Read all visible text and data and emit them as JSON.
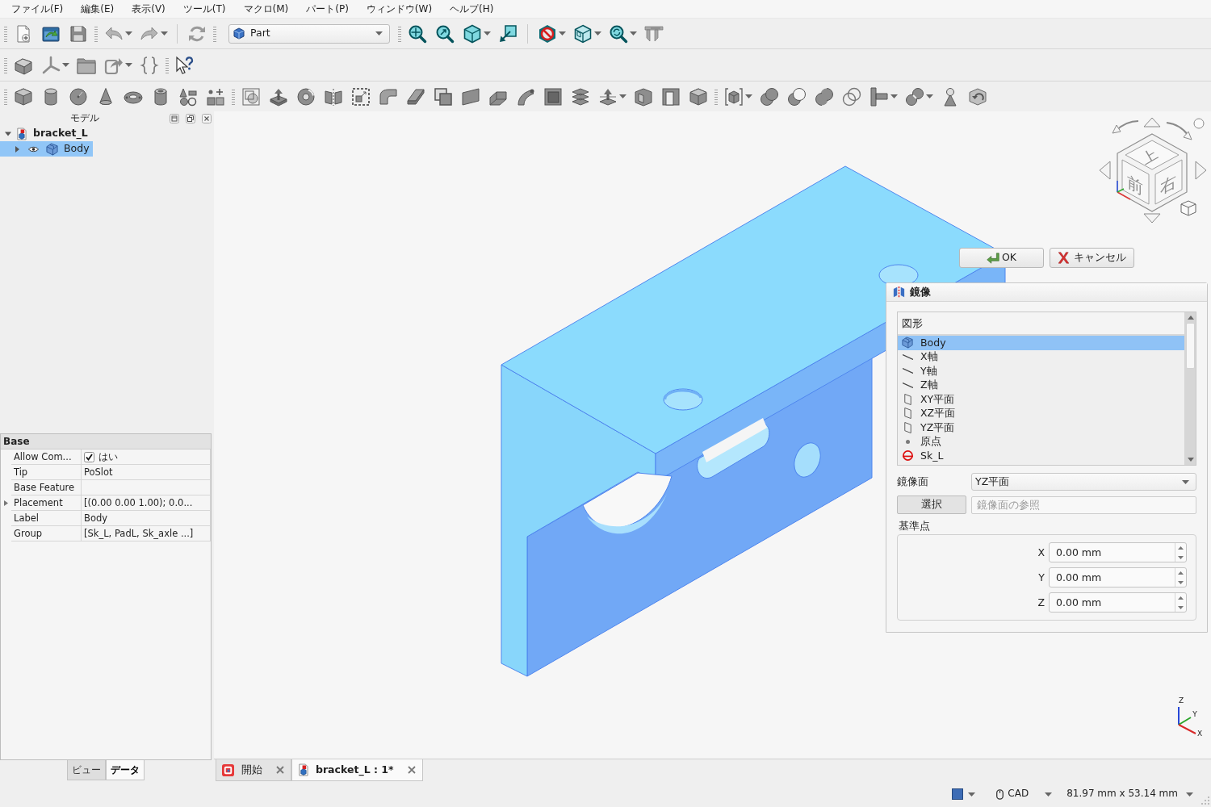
{
  "menu": [
    "ファイル(F)",
    "編集(E)",
    "表示(V)",
    "ツール(T)",
    "マクロ(M)",
    "パート(P)",
    "ウィンドウ(W)",
    "ヘルプ(H)"
  ],
  "workbench": {
    "value": "Part"
  },
  "tree": {
    "title": "モデル",
    "items": [
      {
        "label": "bracket_L",
        "kind": "document",
        "expanded": true,
        "selected": false,
        "children": [
          {
            "label": "Body",
            "kind": "body",
            "expanded": false,
            "selected": true
          }
        ]
      }
    ]
  },
  "properties": {
    "group": "Base",
    "rows": [
      {
        "name": "Allow Com...",
        "kind": "checkbox",
        "checked": true,
        "value": "はい"
      },
      {
        "name": "Tip",
        "kind": "text",
        "value": "PoSlot"
      },
      {
        "name": "Base Feature",
        "kind": "text"
      },
      {
        "name": "Placement",
        "kind": "group",
        "expanded": false,
        "value": "[(0.00 0.00 1.00); 0.0..."
      },
      {
        "name": "Label",
        "kind": "text",
        "value": "Body"
      },
      {
        "name": "Group",
        "kind": "text",
        "value": "[Sk_L, PadL, Sk_axle ...]"
      }
    ]
  },
  "panel_tabs": [
    {
      "label": "ビュー",
      "selected": false
    },
    {
      "label": "データ",
      "selected": true
    }
  ],
  "view": {
    "nav_cube": [
      "上",
      "前",
      "右"
    ],
    "axis_labels": [
      "Z",
      "Y",
      "X"
    ]
  },
  "task": {
    "buttons": [
      {
        "label": "OK",
        "kind": "ok"
      },
      {
        "label": "キャンセル",
        "kind": "cancel"
      }
    ],
    "title": "鏡像",
    "list": {
      "header": "図形",
      "items": [
        {
          "label": "Body",
          "kind": "body",
          "selected": true
        },
        {
          "label": "X軸",
          "kind": "axis",
          "selected": false
        },
        {
          "label": "Y軸",
          "kind": "axis",
          "selected": false
        },
        {
          "label": "Z軸",
          "kind": "axis",
          "selected": false
        },
        {
          "label": "XY平面",
          "kind": "plane",
          "selected": false
        },
        {
          "label": "XZ平面",
          "kind": "plane",
          "selected": false
        },
        {
          "label": "YZ平面",
          "kind": "plane",
          "selected": false
        },
        {
          "label": "原点",
          "kind": "point",
          "selected": false
        },
        {
          "label": "Sk_L",
          "kind": "sketch",
          "selected": false
        }
      ]
    },
    "plane": {
      "label": "鏡像面",
      "value": "YZ平面"
    },
    "select_button": "選択",
    "reference": {
      "placeholder": "鏡像面の参照"
    },
    "base_point": {
      "label": "基準点",
      "fields": [
        {
          "axis": "X",
          "value": "0.00 mm"
        },
        {
          "axis": "Y",
          "value": "0.00 mm"
        },
        {
          "axis": "Z",
          "value": "0.00 mm"
        }
      ]
    }
  },
  "doc_tabs": [
    {
      "label": "開始",
      "kind": "start",
      "selected": false
    },
    {
      "label": "bracket_L : 1*",
      "kind": "document",
      "selected": true
    }
  ],
  "status_bar": {
    "navigation": "CAD",
    "dimensions": "81.97 mm x 53.14 mm"
  }
}
